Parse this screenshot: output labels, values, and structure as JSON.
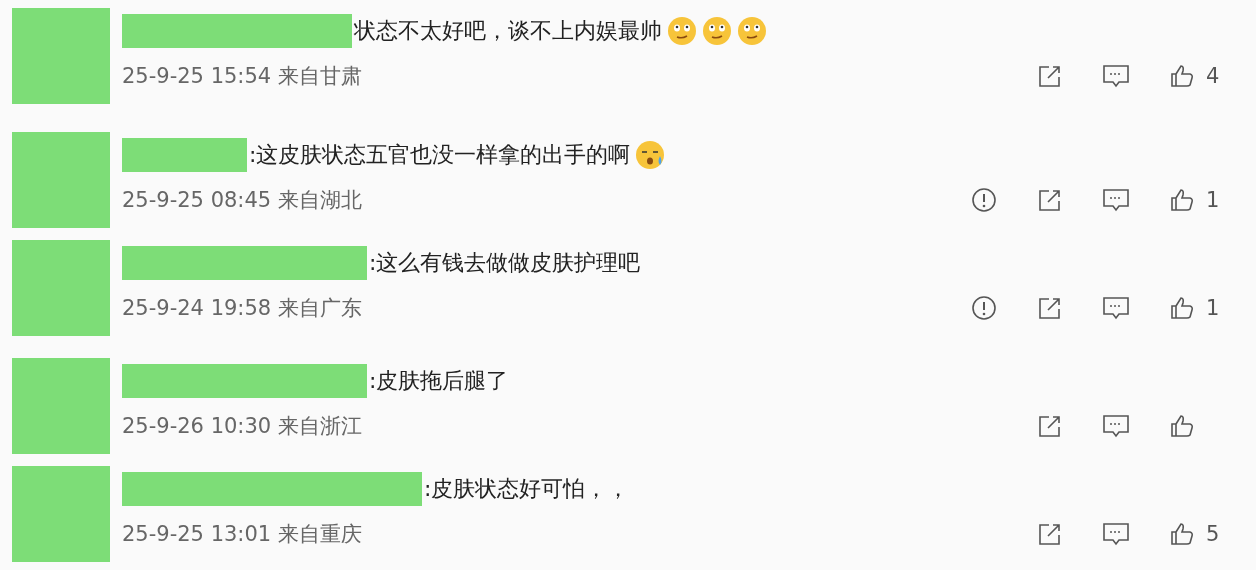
{
  "comments": [
    {
      "text": "状态不太好吧，谈不上内娱最帅",
      "emojis": [
        {
          "kind": "smirk"
        },
        {
          "kind": "smirk"
        },
        {
          "kind": "smirk"
        }
      ],
      "meta": "25-9-25 15:54 来自甘肃",
      "report": false,
      "likes": "4"
    },
    {
      "text": ":这皮肤状态五官也没一样拿的出手的啊",
      "emojis": [
        {
          "kind": "tears"
        }
      ],
      "meta": "25-9-25 08:45 来自湖北",
      "report": true,
      "likes": "1"
    },
    {
      "text": ":这么有钱去做做皮肤护理吧",
      "meta": "25-9-24 19:58 来自广东",
      "report": true,
      "likes": "1"
    },
    {
      "text": ":皮肤拖后腿了",
      "meta": "25-9-26 10:30 来自浙江",
      "report": false
    },
    {
      "text": ":皮肤状态好可怕，，",
      "meta": "25-9-25 13:01 来自重庆",
      "report": false,
      "likes": "5"
    }
  ]
}
